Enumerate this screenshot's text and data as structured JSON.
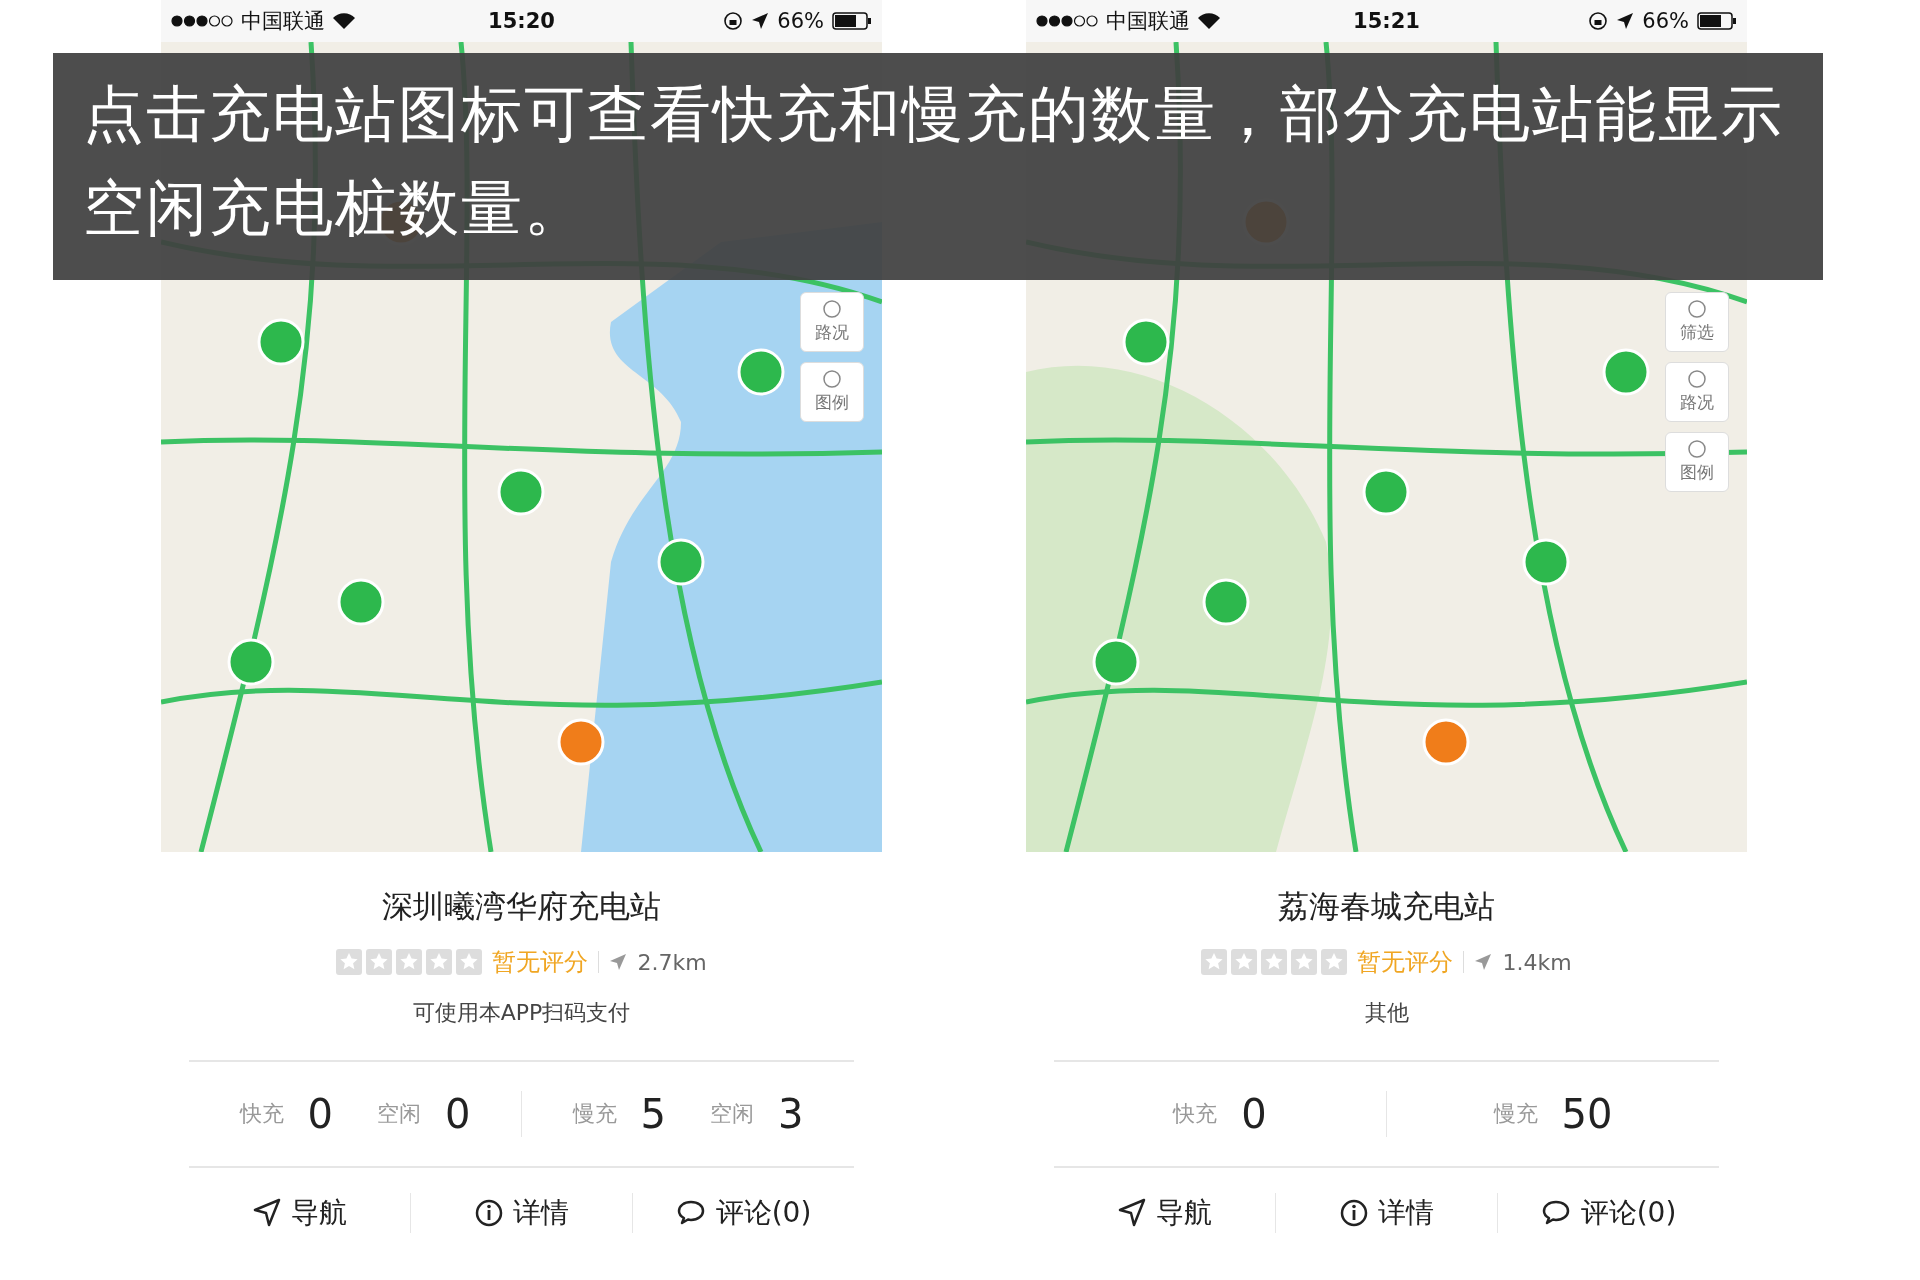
{
  "caption": "点击充电站图标可查看快充和慢充的数量，部分充电站能显示空闲充电桩数量。",
  "phones": [
    {
      "status_bar": {
        "carrier": "中国联通",
        "time": "15:20",
        "battery": "66%"
      },
      "map_controls": [
        "路况",
        "图例"
      ],
      "station": {
        "name": "深圳曦湾华府充电站",
        "stars": 0,
        "rating": "暂无评分",
        "distance": "2.7km",
        "note": "可使用本APP扫码支付",
        "stats": [
          [
            {
              "label": "快充",
              "value": "0"
            },
            {
              "label": "空闲",
              "value": "0"
            }
          ],
          [
            {
              "label": "慢充",
              "value": "5"
            },
            {
              "label": "空闲",
              "value": "3"
            }
          ]
        ]
      },
      "actions": [
        {
          "kind": "navigate",
          "label": "导航"
        },
        {
          "kind": "details",
          "label": "详情"
        },
        {
          "kind": "comments",
          "label": "评论(0)"
        }
      ]
    },
    {
      "status_bar": {
        "carrier": "中国联通",
        "time": "15:21",
        "battery": "66%"
      },
      "map_controls": [
        "筛选",
        "路况",
        "图例"
      ],
      "station": {
        "name": "荔海春城充电站",
        "stars": 0,
        "rating": "暂无评分",
        "distance": "1.4km",
        "note": "其他",
        "stats": [
          [
            {
              "label": "快充",
              "value": "0"
            }
          ],
          [
            {
              "label": "慢充",
              "value": "50"
            }
          ]
        ]
      },
      "actions": [
        {
          "kind": "navigate",
          "label": "导航"
        },
        {
          "kind": "details",
          "label": "详情"
        },
        {
          "kind": "comments",
          "label": "评论(0)"
        }
      ]
    }
  ]
}
